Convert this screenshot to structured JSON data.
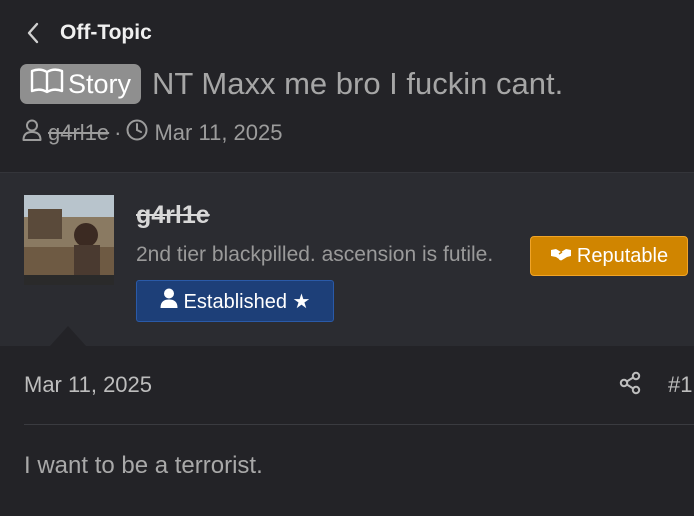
{
  "breadcrumb": {
    "back_label": "Off-Topic",
    "icon": "chevron-left-icon"
  },
  "thread": {
    "prefix_label": "Story",
    "prefix_icon": "book-open-icon",
    "prefix_color": "#8f8f8f",
    "title": "NT Maxx me bro I fuckin cant.",
    "meta": {
      "author": "g4rl1e",
      "separator": "·",
      "date": "Mar 11, 2025"
    }
  },
  "user": {
    "username": "g4rl1e",
    "user_title": "2nd tier blackpilled. ascension is futile.",
    "banners": [
      {
        "label": "Reputable",
        "icon": "handshake-icon",
        "color": "#d08500"
      },
      {
        "label": "Established ★",
        "icon": "user-icon",
        "color": "#1d3f78"
      }
    ]
  },
  "post": {
    "date": "Mar 11, 2025",
    "number": "#1",
    "share_icon": "share-icon",
    "body": "I want to be a terrorist."
  }
}
